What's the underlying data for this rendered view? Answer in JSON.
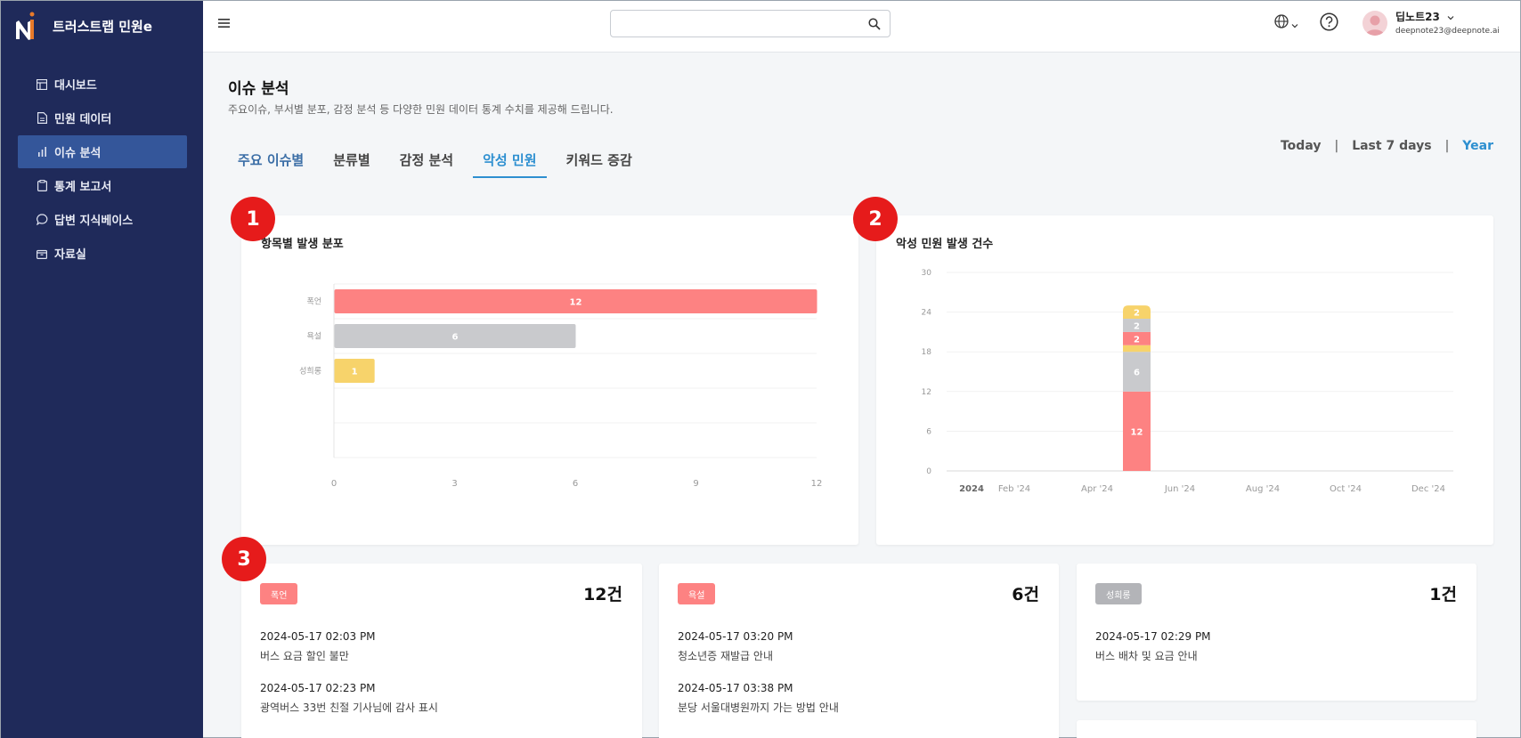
{
  "app": {
    "name": "트러스트랩 민원e"
  },
  "sidebar": {
    "items": [
      {
        "label": "대시보드",
        "icon": "dashboard-icon"
      },
      {
        "label": "민원 데이터",
        "icon": "document-icon"
      },
      {
        "label": "이슈 분석",
        "icon": "bar-chart-icon",
        "active": true
      },
      {
        "label": "통계 보고서",
        "icon": "clipboard-icon"
      },
      {
        "label": "답변 지식베이스",
        "icon": "chat-icon"
      },
      {
        "label": "자료실",
        "icon": "archive-icon"
      }
    ]
  },
  "header": {
    "search_placeholder": "",
    "user_name": "딥노트23",
    "user_email": "deepnote23@deepnote.ai"
  },
  "page": {
    "title": "이슈 분석",
    "description": "주요이슈, 부서별 분포, 감정 분석 등 다양한 민원 데이터 통계 수치를 제공해 드립니다."
  },
  "tabs": [
    "주요 이슈별",
    "분류별",
    "감정 분석",
    "악성 민원",
    "키워드 증감"
  ],
  "active_tab": "악성 민원",
  "range": {
    "today": "Today",
    "last7": "Last 7 days",
    "year": "Year",
    "selected": "Year"
  },
  "markers": [
    "1",
    "2",
    "3"
  ],
  "colors": {
    "red": "#fd8282",
    "gray": "#c9cacd",
    "yellow": "#f7d36b",
    "sidebar": "#1f2a5a",
    "accent": "#2d8fd0"
  },
  "chart_data": [
    {
      "type": "bar",
      "orientation": "horizontal",
      "title": "항목별 발생 분포",
      "categories": [
        "폭언",
        "욕설",
        "성희롱"
      ],
      "values": [
        12,
        6,
        1
      ],
      "colors": [
        "#fd8282",
        "#c9cacd",
        "#f7d36b"
      ],
      "xlim": [
        0,
        12
      ],
      "xticks": [
        "0",
        "3",
        "6",
        "9",
        "12"
      ]
    },
    {
      "type": "bar",
      "stacked": true,
      "title": "악성 민원 발생 건수",
      "x_labels": [
        "2024",
        "Feb '24",
        "Apr '24",
        "Jun '24",
        "Aug '24",
        "Oct '24",
        "Dec '24"
      ],
      "ylim": [
        0,
        30
      ],
      "yticks": [
        "0",
        "6",
        "12",
        "18",
        "24",
        "30"
      ],
      "bar_date": "2024-05-17",
      "segments": [
        {
          "value": 12,
          "color": "#fd8282",
          "label": "12"
        },
        {
          "value": 6,
          "color": "#c9cacd",
          "label": "6"
        },
        {
          "value": 1,
          "color": "#f7d36b",
          "label": ""
        },
        {
          "value": 2,
          "color": "#fd8282",
          "label": "2"
        },
        {
          "value": 2,
          "color": "#c9cacd",
          "label": "2"
        },
        {
          "value": 2,
          "color": "#f7d36b",
          "label": "2"
        }
      ]
    }
  ],
  "categories": [
    {
      "badge": "폭언",
      "badge_color": "#fd8282",
      "count": "12건",
      "entries": [
        {
          "time": "2024-05-17 02:03 PM",
          "text": "버스 요금 할인 불만"
        },
        {
          "time": "2024-05-17 02:23 PM",
          "text": "광역버스 33번 친절 기사님에 감사 표시"
        }
      ]
    },
    {
      "badge": "욕설",
      "badge_color": "#fd8282",
      "count": "6건",
      "entries": [
        {
          "time": "2024-05-17 03:20 PM",
          "text": "청소년증 재발급 안내"
        },
        {
          "time": "2024-05-17 03:38 PM",
          "text": "분당 서울대병원까지 가는 방법 안내"
        }
      ]
    },
    {
      "badge": "성희롱",
      "badge_color": "#b3b4b8",
      "count": "1건",
      "entries": [
        {
          "time": "2024-05-17 02:29 PM",
          "text": "버스 배차 및 요금 안내"
        }
      ]
    }
  ]
}
